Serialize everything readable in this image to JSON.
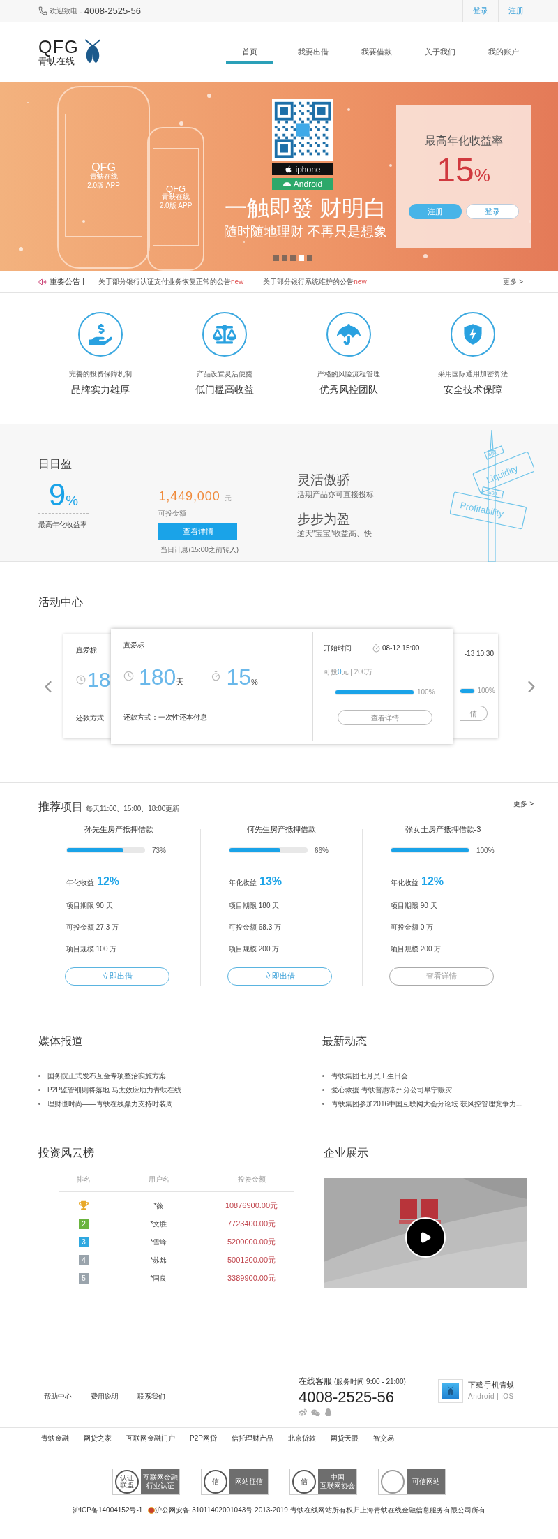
{
  "topbar": {
    "phone_label": "欢迎致电：",
    "phone": "4008-2525-56",
    "links": [
      "登录",
      "注册"
    ]
  },
  "header": {
    "logo": "QFG",
    "logo_sub": "青蚨在线",
    "nav": [
      {
        "label": "首页",
        "selected": true
      },
      {
        "label": "我要出借",
        "selected": false
      },
      {
        "label": "我要借款",
        "selected": false
      },
      {
        "label": "关于我们",
        "selected": false
      },
      {
        "label": "我的账户",
        "selected": false
      }
    ]
  },
  "banner": {
    "phones": [
      {
        "logo": "QFG",
        "logo_sub": "青蚨在线",
        "caption": "2.0版 APP"
      },
      {
        "logo": "QFG",
        "logo_sub": "青蚨在线",
        "caption": "2.0版 APP"
      }
    ],
    "downloads": [
      {
        "kind": "ios",
        "label": "iphone"
      },
      {
        "kind": "android",
        "label": "Android"
      }
    ],
    "slogan": "一触即發 财明白",
    "subslogan": "随时随地理财 不再只是想象",
    "promo": {
      "title": "最高年化收益率",
      "rate": "15",
      "unit": "%",
      "buttons": [
        {
          "label": "注册",
          "kind": "primary"
        },
        {
          "label": "登录",
          "kind": "outline"
        }
      ]
    },
    "dots": [
      {
        "selected": false
      },
      {
        "selected": false
      },
      {
        "selected": false
      },
      {
        "selected": true
      },
      {
        "selected": false
      }
    ]
  },
  "notices": {
    "label": "重要公告 |",
    "items": [
      {
        "text": "关于部分银行认证支付业务恢复正常的公告",
        "badge": "new"
      },
      {
        "text": "关于部分银行系统维护的公告",
        "badge": "new"
      }
    ],
    "more": "更多 >"
  },
  "features": [
    {
      "caption": "完善的投资保障机制",
      "title": "品牌实力雄厚"
    },
    {
      "caption": "产品设置灵活便捷",
      "title": "低门槛高收益"
    },
    {
      "caption": "严格的风险流程管理",
      "title": "优秀风控团队"
    },
    {
      "caption": "采用国际通用加密算法",
      "title": "安全技术保障"
    }
  ],
  "daily": {
    "title": "日日盈",
    "rate": "9",
    "unit": "%",
    "rate_label": "最高年化收益率",
    "amount": "1,449,000",
    "amount_unit": "元",
    "amount_label": "可投金额",
    "button": "查看详情",
    "note": "当日计息(15:00之前转入)",
    "slogans": [
      {
        "title": "灵活傲骄",
        "text": "活期产品亦可直接投标"
      },
      {
        "title": "步步为盈",
        "text": "逆天\"宝宝\"收益高、快"
      }
    ],
    "signs": [
      {
        "label": "Liquidity",
        "distance": "600"
      },
      {
        "label": "Profitability",
        "distance": "1500"
      }
    ]
  },
  "activity": {
    "title": "活动中心",
    "back_left": {
      "name": "真爱标",
      "days": "18",
      "repay": "还款方式"
    },
    "front": {
      "name": "真爱标",
      "days": "180",
      "days_unit": "天",
      "rate": "15",
      "rate_unit": "%",
      "repay": "还款方式：一次性还本付息",
      "start_label": "开始时间",
      "start_time": "08-12 15:00",
      "avail_prefix": "可投",
      "avail_amount": "0",
      "avail_suffix": "元 | 200万",
      "level": 1,
      "percent": "100%",
      "button": "查看详情"
    },
    "back_right": {
      "time": "-13 10:30",
      "level": 1,
      "percent": "100%",
      "button": "情"
    }
  },
  "recommend": {
    "title": "推荐项目",
    "subtitle": "每天11:00、15:00、18:00更新",
    "more": "更多 >",
    "projects": [
      {
        "name": "孙先生房产抵押借款",
        "level": 0.73,
        "percent": "73%",
        "rate_label": "年化收益",
        "rate": "12%",
        "term": "项目期限 90 天",
        "available": "可投金额 27.3 万",
        "scale": "项目规模 100 万",
        "button": "立即出借",
        "open": true
      },
      {
        "name": "何先生房产抵押借款",
        "level": 0.66,
        "percent": "66%",
        "rate_label": "年化收益",
        "rate": "13%",
        "term": "项目期限 180 天",
        "available": "可投金额 68.3 万",
        "scale": "项目规模 200 万",
        "button": "立即出借",
        "open": true
      },
      {
        "name": "张女士房产抵押借款-3",
        "level": 1,
        "percent": "100%",
        "rate_label": "年化收益",
        "rate": "12%",
        "term": "项目期限 90 天",
        "available": "可投金额 0 万",
        "scale": "项目规模 200 万",
        "button": "查看详情",
        "open": false
      }
    ]
  },
  "media": {
    "title": "媒体报道",
    "items": [
      "国务院正式发布互金专项整治实施方案",
      "P2P监管细则将落地 马太效应助力青蚨在线",
      "理财也时尚——青蚨在线鼎力支持时装周"
    ]
  },
  "news": {
    "title": "最新动态",
    "items": [
      "青蚨集团七月员工生日会",
      "爱心救援 青蚨普惠常州分公司阜宁赈灾",
      "青蚨集团参加2016中国互联网大会分论坛 获风控管理竞争力..."
    ]
  },
  "ranking": {
    "title": "投资风云榜",
    "columns": [
      "排名",
      "用户名",
      "投资金额"
    ],
    "rows": [
      {
        "kind": "trophy",
        "color": "#e8a828",
        "user": "*薇",
        "amount": "10876900.00元"
      },
      {
        "kind": "number",
        "rank": "2",
        "color": "#6ab43e",
        "user": "*文胜",
        "amount": "7723400.00元"
      },
      {
        "kind": "number",
        "rank": "3",
        "color": "#2fa8e0",
        "user": "*雪峰",
        "amount": "5200000.00元"
      },
      {
        "kind": "number",
        "rank": "4",
        "color": "#9aa4ac",
        "user": "*苏炜",
        "amount": "5001200.00元"
      },
      {
        "kind": "number",
        "rank": "5",
        "color": "#9aa4ac",
        "user": "*国良",
        "amount": "3389900.00元"
      }
    ]
  },
  "showcase": {
    "title": "企业展示"
  },
  "footer": {
    "links": [
      "帮助中心",
      "费用说明",
      "联系我们"
    ],
    "service_label": "在线客服",
    "service_hours": "(服务时间 9:00 - 21:00)",
    "phone": "4008-2525-56",
    "app_title": "下载手机青蚨",
    "app_platforms": "Android | iOS",
    "partners": [
      "青蚨金融",
      "网贷之家",
      "互联网金融门户",
      "P2P网贷",
      "信托理财产品",
      "北京贷款",
      "网贷天眼",
      "智交易"
    ],
    "badges": [
      {
        "seal": "认证联盟",
        "lines": [
          "互联网金融",
          "行业认证"
        ]
      },
      {
        "seal": "信",
        "lines": [
          "网站征信"
        ]
      },
      {
        "seal": "信",
        "lines": [
          "中国",
          "互联网协会"
        ]
      },
      {
        "lines": [
          "可信网站"
        ]
      }
    ],
    "icp": "沪ICP备14004152号-1",
    "police": "沪公网安备 31011402001043号 2013-2019 青蚨在线网站所有权归上海青蚨在线金融信息服务有限公司所有"
  }
}
